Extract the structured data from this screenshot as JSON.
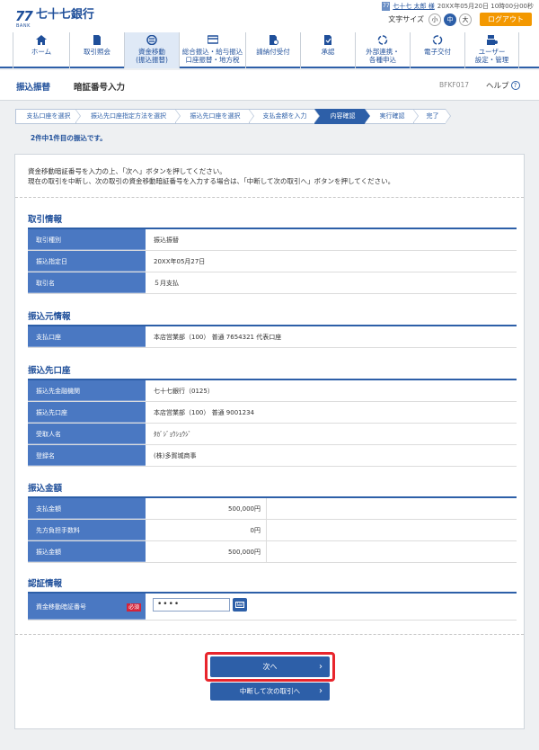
{
  "bank": {
    "mark": "77",
    "bank_label": "BANK",
    "name": "七十七銀行"
  },
  "user": {
    "icon": "77",
    "name": "七十七 太郎 様",
    "datetime": "20XX年05月20日 10時00分00秒"
  },
  "font_size": {
    "label": "文字サイズ",
    "options": [
      "小",
      "中",
      "大"
    ],
    "selected": "中"
  },
  "logout_label": "ログアウト",
  "nav": [
    {
      "label": "ホーム",
      "icon": "home-icon"
    },
    {
      "label": "取引照会",
      "icon": "document-icon"
    },
    {
      "label": "資金移動\n(振込振替)",
      "icon": "transfer-icon",
      "active": true
    },
    {
      "label": "総合振込・給与振込\n口座振替・地方税",
      "icon": "card-icon"
    },
    {
      "label": "請納付受付",
      "icon": "payment-icon"
    },
    {
      "label": "承認",
      "icon": "approve-icon"
    },
    {
      "label": "外部連携・\n各種申込",
      "icon": "link-icon"
    },
    {
      "label": "電子交付",
      "icon": "exchange-icon"
    },
    {
      "label": "ユーザー\n設定・管理",
      "icon": "user-settings-icon"
    }
  ],
  "header": {
    "section": "振込振替",
    "title": "暗証番号入力",
    "screen_id": "BFKF017",
    "help_label": "ヘルプ"
  },
  "steps": [
    "支払口座を選択",
    "振込先口座指定方法を選択",
    "振込先口座を選択",
    "支払金額を入力",
    "内容確認",
    "実行確認",
    "完了"
  ],
  "current_step": "内容確認",
  "page_label": "2件中1件目の振込です。",
  "instructions": [
    "資金移動暗証番号を入力の上、「次へ」ボタンを押してください。",
    "現在の取引を中断し、次の取引の資金移動暗証番号を入力する場合は、「中断して次の取引へ」ボタンを押してください。"
  ],
  "sections": {
    "tx": {
      "title": "取引情報",
      "rows": [
        {
          "label": "取引種別",
          "value": "振込振替"
        },
        {
          "label": "振込指定日",
          "value": "20XX年05月27日"
        },
        {
          "label": "取引名",
          "value": "５月支払"
        }
      ]
    },
    "from": {
      "title": "振込元情報",
      "rows": [
        {
          "label": "支払口座",
          "value": "本店営業部（100） 普通 7654321 代表口座"
        }
      ]
    },
    "to": {
      "title": "振込先口座",
      "rows": [
        {
          "label": "振込先金融機関",
          "value": "七十七銀行（0125）"
        },
        {
          "label": "振込先口座",
          "value": "本店営業部（100） 普通 9001234"
        },
        {
          "label": "受取人名",
          "value": "ﾀｶﾞｼﾞｮｳｼｮｳｼﾞ"
        },
        {
          "label": "登録名",
          "value": "(株)多賀城商事"
        }
      ]
    },
    "amount": {
      "title": "振込金額",
      "rows": [
        {
          "label": "支払金額",
          "value": "500,000円"
        },
        {
          "label": "先方負担手数料",
          "value": "0円"
        },
        {
          "label": "振込金額",
          "value": "500,000円"
        }
      ]
    },
    "auth": {
      "title": "認証情報",
      "label": "資金移動暗証番号",
      "required": "必須",
      "masked_value": "••••"
    }
  },
  "buttons": {
    "next": "次へ",
    "suspend": "中断して次の取引へ"
  },
  "colors": {
    "primary": "#2d5fa8",
    "header_cell": "#4a78c2",
    "logout": "#f39800",
    "required": "#d4233a",
    "highlight": "#e8252c"
  }
}
